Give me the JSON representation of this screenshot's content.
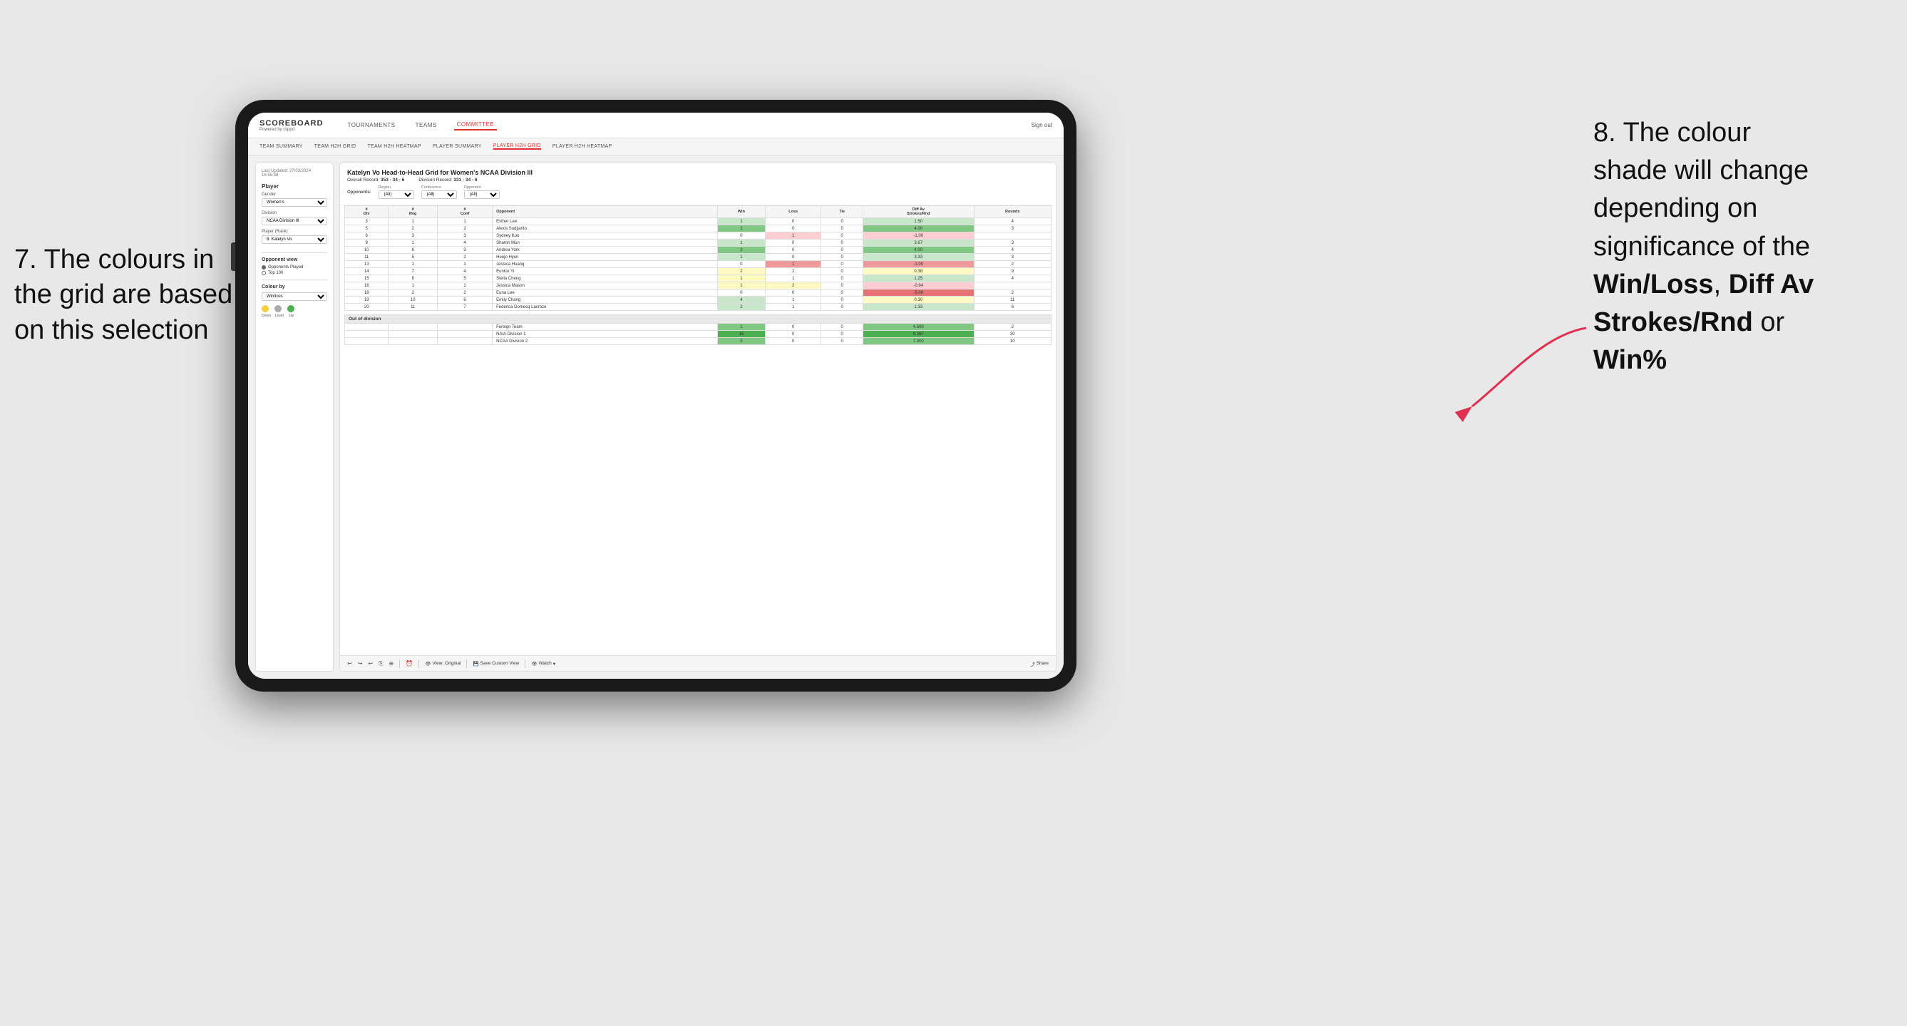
{
  "annotations": {
    "left": {
      "line1": "7. The colours in",
      "line2": "the grid are based",
      "line3": "on this selection"
    },
    "right": {
      "line1": "8. The colour",
      "line2": "shade will change",
      "line3": "depending on",
      "line4": "significance of the",
      "bold1": "Win/Loss",
      "comma1": ", ",
      "bold2": "Diff Av",
      "line5": "Strokes/Rnd",
      "word1": " or",
      "bold3": "Win%"
    }
  },
  "nav": {
    "logo": "SCOREBOARD",
    "logo_sub": "Powered by clippd",
    "items": [
      "TOURNAMENTS",
      "TEAMS",
      "COMMITTEE"
    ],
    "active_item": "COMMITTEE",
    "sign_in": "Sign out"
  },
  "second_nav": {
    "items": [
      "TEAM SUMMARY",
      "TEAM H2H GRID",
      "TEAM H2H HEATMAP",
      "PLAYER SUMMARY",
      "PLAYER H2H GRID",
      "PLAYER H2H HEATMAP"
    ],
    "active_item": "PLAYER H2H GRID"
  },
  "sidebar": {
    "timestamp": "Last Updated: 27/03/2024 16:55:38",
    "player_section": "Player",
    "gender_label": "Gender",
    "gender_value": "Women's",
    "division_label": "Division",
    "division_value": "NCAA Division III",
    "player_rank_label": "Player (Rank)",
    "player_rank_value": "8. Katelyn Vo",
    "opponent_view_title": "Opponent view",
    "radio_options": [
      "Opponents Played",
      "Top 100"
    ],
    "radio_selected": "Opponents Played",
    "colour_by_title": "Colour by",
    "colour_by_value": "Win/loss",
    "colour_legend": {
      "down": "Down",
      "level": "Level",
      "up": "Up"
    }
  },
  "main_panel": {
    "title": "Katelyn Vo Head-to-Head Grid for Women's NCAA Division III",
    "overall_record_label": "Overall Record:",
    "overall_record_value": "353 - 34 - 6",
    "division_record_label": "Division Record:",
    "division_record_value": "331 - 34 - 6",
    "opponents_label": "Opponents:",
    "region_label": "Region",
    "region_value": "(All)",
    "conference_label": "Conference",
    "conference_value": "(All)",
    "opponent_label": "Opponent",
    "opponent_value": "(All)",
    "columns": {
      "div": "#\nDiv",
      "reg": "#\nReg",
      "conf": "#\nConf",
      "opponent": "Opponent",
      "win": "Win",
      "loss": "Loss",
      "tie": "Tie",
      "diff_av": "Diff Av\nStrokes/Rnd",
      "rounds": "Rounds"
    },
    "rows": [
      {
        "div": "3",
        "reg": "1",
        "conf": "1",
        "name": "Esther Lee",
        "win": 1,
        "loss": 0,
        "tie": 0,
        "diff_av": "1.50",
        "rounds": "4",
        "win_color": "green_light",
        "diff_color": "green_light"
      },
      {
        "div": "5",
        "reg": "2",
        "conf": "2",
        "name": "Alexis Sudjianto",
        "win": 1,
        "loss": 0,
        "tie": 0,
        "diff_av": "4.00",
        "rounds": "3",
        "win_color": "green_mid",
        "diff_color": "green_mid"
      },
      {
        "div": "6",
        "reg": "3",
        "conf": "3",
        "name": "Sydney Kuo",
        "win": 0,
        "loss": 1,
        "tie": 0,
        "diff_av": "-1.00",
        "rounds": "",
        "win_color": "none",
        "diff_color": "red_light",
        "loss_color": "red_light"
      },
      {
        "div": "9",
        "reg": "1",
        "conf": "4",
        "name": "Sharon Mun",
        "win": 1,
        "loss": 0,
        "tie": 0,
        "diff_av": "3.67",
        "rounds": "3",
        "win_color": "green_light",
        "diff_color": "green_light"
      },
      {
        "div": "10",
        "reg": "6",
        "conf": "3",
        "name": "Andrea York",
        "win": 2,
        "loss": 0,
        "tie": 0,
        "diff_av": "4.00",
        "rounds": "4",
        "win_color": "green_mid",
        "diff_color": "green_mid"
      },
      {
        "div": "11",
        "reg": "5",
        "conf": "2",
        "name": "Heejo Hyun",
        "win": 1,
        "loss": 0,
        "tie": 0,
        "diff_av": "3.33",
        "rounds": "3",
        "win_color": "green_light",
        "diff_color": "green_light"
      },
      {
        "div": "13",
        "reg": "1",
        "conf": "1",
        "name": "Jessica Huang",
        "win": 0,
        "loss": 1,
        "tie": 0,
        "diff_av": "-3.00",
        "rounds": "2",
        "win_color": "none",
        "diff_color": "red_mid",
        "loss_color": "red_mid"
      },
      {
        "div": "14",
        "reg": "7",
        "conf": "4",
        "name": "Eunice Yi",
        "win": 2,
        "loss": 2,
        "tie": 0,
        "diff_av": "0.38",
        "rounds": "9",
        "win_color": "yellow",
        "diff_color": "yellow"
      },
      {
        "div": "15",
        "reg": "8",
        "conf": "5",
        "name": "Stella Cheng",
        "win": 1,
        "loss": 1,
        "tie": 0,
        "diff_av": "1.25",
        "rounds": "4",
        "win_color": "yellow",
        "diff_color": "green_light"
      },
      {
        "div": "16",
        "reg": "1",
        "conf": "1",
        "name": "Jessica Mason",
        "win": 1,
        "loss": 2,
        "tie": 0,
        "diff_av": "-0.94",
        "rounds": "",
        "win_color": "yellow",
        "diff_color": "red_light",
        "loss_color": "yellow"
      },
      {
        "div": "18",
        "reg": "2",
        "conf": "2",
        "name": "Euna Lee",
        "win": 0,
        "loss": 0,
        "tie": 0,
        "diff_av": "-5.00",
        "rounds": "2",
        "win_color": "none",
        "diff_color": "red_dark"
      },
      {
        "div": "19",
        "reg": "10",
        "conf": "6",
        "name": "Emily Chang",
        "win": 4,
        "loss": 1,
        "tie": 0,
        "diff_av": "0.30",
        "rounds": "11",
        "win_color": "green_light",
        "diff_color": "yellow"
      },
      {
        "div": "20",
        "reg": "11",
        "conf": "7",
        "name": "Federica Domecq Lacroze",
        "win": 2,
        "loss": 1,
        "tie": 0,
        "diff_av": "1.33",
        "rounds": "6",
        "win_color": "green_light",
        "diff_color": "green_light"
      }
    ],
    "out_of_division_rows": [
      {
        "name": "Foreign Team",
        "win": 1,
        "loss": 0,
        "tie": 0,
        "diff_av": "4.500",
        "rounds": "2",
        "win_color": "green_mid",
        "diff_color": "green_mid"
      },
      {
        "name": "NAIA Division 1",
        "win": 15,
        "loss": 0,
        "tie": 0,
        "diff_av": "9.267",
        "rounds": "30",
        "win_color": "green_dark",
        "diff_color": "green_dark"
      },
      {
        "name": "NCAA Division 2",
        "win": 5,
        "loss": 0,
        "tie": 0,
        "diff_av": "7.400",
        "rounds": "10",
        "win_color": "green_mid",
        "diff_color": "green_mid"
      }
    ]
  },
  "toolbar": {
    "view_original": "View: Original",
    "save_custom": "Save Custom View",
    "watch": "Watch",
    "share": "Share"
  }
}
